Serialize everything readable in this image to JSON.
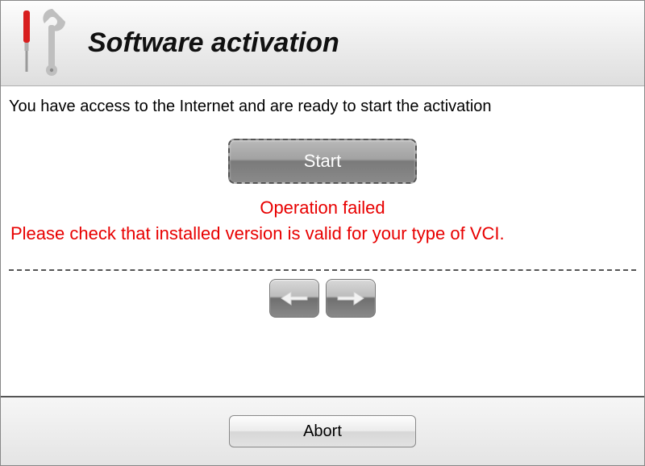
{
  "header": {
    "title": "Software activation",
    "icon": "screwdriver-wrench-icon"
  },
  "main": {
    "intro_text": "You have access to the Internet and are ready to start the activation",
    "start_label": "Start",
    "error_line1": "Operation failed",
    "error_line2": "Please check that installed version is valid for your type of VCI.",
    "nav": {
      "back_icon": "arrow-left-icon",
      "forward_icon": "arrow-right-icon"
    }
  },
  "footer": {
    "abort_label": "Abort"
  },
  "colors": {
    "error": "#e80000"
  }
}
